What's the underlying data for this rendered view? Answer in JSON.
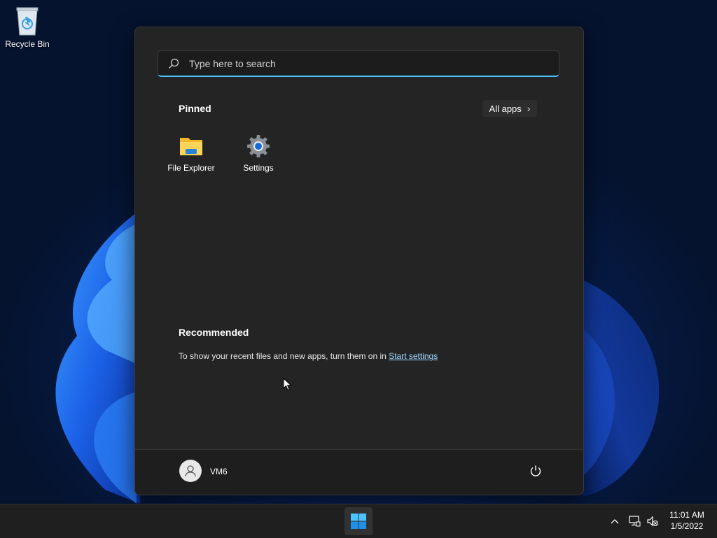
{
  "desktop": {
    "recycle_bin_label": "Recycle Bin"
  },
  "start_menu": {
    "search_placeholder": "Type here to search",
    "pinned_title": "Pinned",
    "all_apps_label": "All apps",
    "pinned_apps": [
      {
        "label": "File Explorer",
        "icon": "folder-icon"
      },
      {
        "label": "Settings",
        "icon": "gear-icon"
      }
    ],
    "recommended_title": "Recommended",
    "recommended_text": "To show your recent files and new apps, turn them on in",
    "recommended_link": "Start settings",
    "user_name": "VM6"
  },
  "taskbar": {
    "time": "11:01 AM",
    "date": "1/5/2022"
  },
  "colors": {
    "accent": "#4cc2ff",
    "start_bg": "#242424",
    "taskbar_bg": "#1f1f1f"
  }
}
